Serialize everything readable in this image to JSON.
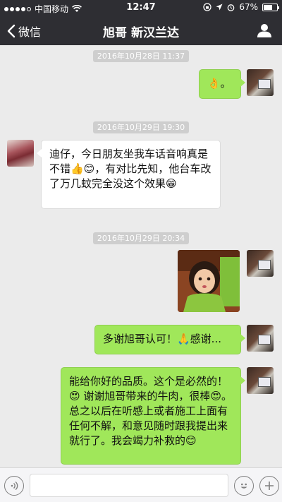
{
  "status_bar": {
    "carrier": "中国移动",
    "time": "12:47",
    "battery": "67%",
    "battery_level": 0.67
  },
  "nav": {
    "back_label": "微信",
    "title": "旭哥 新汉兰达"
  },
  "messages": [
    {
      "type": "timestamp",
      "text": "2016年10月28日 11:37"
    },
    {
      "type": "text",
      "sender": "me",
      "text": "👌。"
    },
    {
      "type": "timestamp",
      "text": "2016年10月29日 19:30"
    },
    {
      "type": "text",
      "sender": "other",
      "text": "迪仔，今日朋友坐我车话音响真是不错👍😊，有对比先知，他台车改了万几蚊完全没这个效果😁"
    },
    {
      "type": "timestamp",
      "text": "2016年10月29日 20:34"
    },
    {
      "type": "image",
      "sender": "me"
    },
    {
      "type": "text",
      "sender": "me",
      "text": "多谢旭哥认可！🙏感谢..."
    },
    {
      "type": "text",
      "sender": "me",
      "text": "能给你好的品质。这个是必然的！😍 谢谢旭哥带来的牛肉，很棒😍。总之以后在听感上或者施工上面有任何不解，和意见随时跟我提出来就行了。我会竭力补救的😊"
    }
  ],
  "input": {
    "value": ""
  },
  "icons": {
    "back": "chevron-left-icon",
    "profile": "person-icon",
    "voice": "voice-icon",
    "emoji": "emoji-icon",
    "plus": "plus-icon"
  },
  "colors": {
    "bar": "#2e2e33",
    "chat_bg": "#ebebeb",
    "bubble_me": "#a0e75a",
    "bubble_other": "#ffffff"
  }
}
